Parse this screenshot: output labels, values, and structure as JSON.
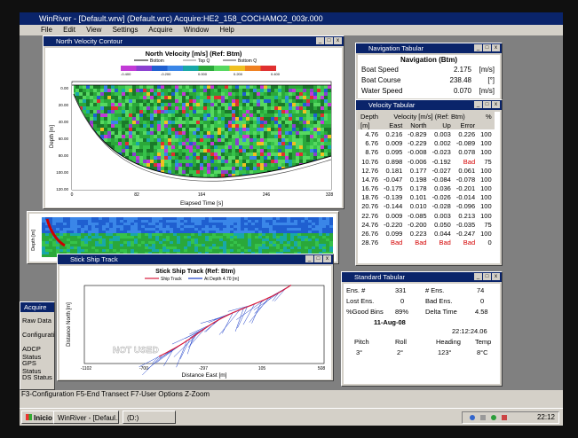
{
  "app": {
    "title": "WinRiver - [Default.wrw] (Default.wrc) Acquire:HE2_158_COCHAMO2_003r.000",
    "menu": [
      "File",
      "Edit",
      "View",
      "Settings",
      "Acquire",
      "Window",
      "Help"
    ]
  },
  "contour": {
    "window_title": "North Velocity Contour",
    "chart_title": "North Velocity [m/s] (Ref: Btm)",
    "legend_items": [
      "Bottom",
      "Top Q",
      "Bottom Q"
    ],
    "colorbar_ticks": [
      "-0.400",
      "-0.200",
      "0.000",
      "0.200",
      "0.400"
    ],
    "y_label": "Depth [m]",
    "y_ticks": [
      "0.00",
      "20.00",
      "40.00",
      "60.00",
      "80.00",
      "100.00",
      "120.00"
    ],
    "x_label": "Elapsed Time [s]",
    "x_ticks": [
      "0",
      "82",
      "164",
      "246",
      "328"
    ]
  },
  "second_contour": {
    "y_label": "Depth [m]"
  },
  "ship_track": {
    "window_title": "Stick Ship Track",
    "chart_title": "Stick Ship Track (Ref: Btm)",
    "legend": [
      "Ship Track",
      "At Depth 4.70 [m]"
    ],
    "y_label": "Distance North [m]",
    "x_label": "Distance East [m]",
    "x_ticks": [
      "-1102",
      "-700",
      "-297",
      "105",
      "508"
    ]
  },
  "navigation": {
    "window_title": "Navigation Tabular",
    "header": "Navigation (Btm)",
    "rows": [
      {
        "label": "Boat Speed",
        "value": "2.175",
        "unit": "[m/s]"
      },
      {
        "label": "Boat Course",
        "value": "238.48",
        "unit": "[°]"
      },
      {
        "label": "Water Speed",
        "value": "0.070",
        "unit": "[m/s]"
      }
    ]
  },
  "velocity": {
    "window_title": "Velocity Tabular",
    "col_depth": "Depth",
    "col_group": "Velocity [m/s] (Ref: Btm)",
    "col_pct": "%",
    "unit_row": [
      "[m]",
      "East",
      "North",
      "Up",
      "Error",
      ""
    ],
    "rows": [
      [
        "4.76",
        "0.216",
        "-0.829",
        "0.003",
        "0.226",
        "100"
      ],
      [
        "6.76",
        "0.009",
        "-0.229",
        "0.002",
        "-0.089",
        "100"
      ],
      [
        "8.76",
        "0.095",
        "-0.008",
        "-0.023",
        "0.078",
        "100"
      ],
      [
        "10.76",
        "0.898",
        "-0.006",
        "-0.192",
        "Bad",
        "75"
      ],
      [
        "12.76",
        "0.181",
        "0.177",
        "-0.027",
        "0.061",
        "100"
      ],
      [
        "14.76",
        "-0.047",
        "0.198",
        "-0.084",
        "-0.078",
        "100"
      ],
      [
        "16.76",
        "-0.175",
        "0.178",
        "0.036",
        "-0.201",
        "100"
      ],
      [
        "18.76",
        "-0.139",
        "0.101",
        "-0.026",
        "-0.014",
        "100"
      ],
      [
        "20.76",
        "-0.144",
        "0.010",
        "-0.028",
        "-0.096",
        "100"
      ],
      [
        "22.76",
        "0.009",
        "-0.085",
        "0.003",
        "0.213",
        "100"
      ],
      [
        "24.76",
        "-0.220",
        "-0.200",
        "0.050",
        "-0.035",
        "75"
      ],
      [
        "26.76",
        "0.099",
        "0.223",
        "0.044",
        "-0.247",
        "100"
      ],
      [
        "28.76",
        "Bad",
        "Bad",
        "Bad",
        "Bad",
        "0"
      ]
    ]
  },
  "standard": {
    "window_title": "Standard Tabular",
    "ens_label": "Ens. #",
    "ens_value": "331",
    "nens_label": "# Ens.",
    "nens_value": "74",
    "lost_label": "Lost Ens.",
    "lost_value": "0",
    "bad_label": "Bad Ens.",
    "bad_value": "0",
    "good_label": "%Good Bins",
    "good_value": "89%",
    "delta_label": "Delta Time",
    "delta_value": "4.58",
    "date": "11-Aug-08",
    "time": "22:12:24.06",
    "pitch_label": "Pitch",
    "roll_label": "Roll",
    "heading_label": "Heading",
    "temp_label": "Temp",
    "pitch_value": "3°",
    "roll_value": "2°",
    "heading_value": "123°",
    "temp_value": "8°C"
  },
  "acquire_panel": {
    "window_title": "Acquire",
    "items": [
      "Raw Data",
      "Configuration",
      "ADCP Status",
      "GPS Status",
      "DS Status"
    ],
    "overlay_text": "NOT USED"
  },
  "statusbar": {
    "text": "F3-Configuration   F5-End Transect   F7-User Options   Z-Zoom"
  },
  "taskbar": {
    "start": "Inicio",
    "buttons": [
      "WinRiver - [Defaul...",
      "(D:)"
    ],
    "clock": "22:12"
  },
  "colors": {
    "ship_track": "#d81b3c",
    "sticks": "#1a3cc8",
    "titlebar": "#0a246a"
  }
}
